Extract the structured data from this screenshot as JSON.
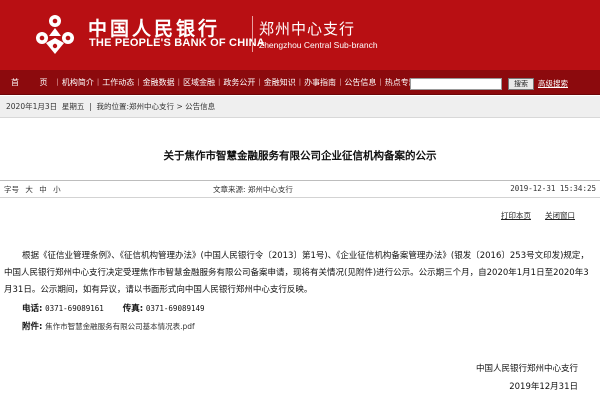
{
  "header": {
    "bank_name_cn": "中国人民银行",
    "bank_name_en": "THE PEOPLE'S BANK OF CHINA",
    "branch_cn": "郑州中心支行",
    "branch_en": "Zhengzhou  Central  Sub-branch",
    "brand_color": "#b80f13",
    "logo_icon": "pboc-logo-icon"
  },
  "nav": {
    "items": [
      "首 页",
      "机构简介",
      "工作动态",
      "金融数据",
      "区域金融",
      "政务公开",
      "金融知识",
      "办事指南",
      "公告信息",
      "热点专题"
    ],
    "search_placeholder": "",
    "search_button": "搜索",
    "advanced_search": "高级搜索",
    "bg_color": "#8c0a0d"
  },
  "crumb": {
    "date": "2020年1月3日",
    "weekday": "星期五",
    "position_label": "我的位置:",
    "path": [
      "郑州中心支行",
      "公告信息"
    ],
    "separators": [
      "|",
      ">"
    ]
  },
  "article": {
    "title": "关于焦作市智慧金融服务有限公司企业征信机构备案的公示",
    "font_size_label": "字号",
    "font_sizes": [
      "大",
      "中",
      "小"
    ],
    "source_label": "文章来源:",
    "source": "郑州中心支行",
    "publish_time": "2019-12-31  15:34:25",
    "print_link": "打印本页",
    "close_link": "关闭窗口",
    "paragraph": "根据《征信业管理条例》、《征信机构管理办法》(中国人民银行令〔2013〕第1号)、《企业征信机构备案管理办法》(银发〔2016〕253号文印发)规定，中国人民银行郑州中心支行决定受理焦作市智慧金融服务有限公司备案申请，现将有关情况(见附件)进行公示。公示期三个月，自2020年1月1日至2020年3月31日。公示期间，如有异议，请以书面形式向中国人民银行郑州中心支行反映。",
    "phone_label": "电话:",
    "phone": "0371-69089161",
    "fax_label": "传真:",
    "fax": "0371-69089149",
    "attachment_label": "附件:",
    "attachment": "焦作市智慧金融服务有限公司基本情况表.pdf",
    "sign_org": "中国人民银行郑州中心支行",
    "sign_date": "2019年12月31日"
  }
}
